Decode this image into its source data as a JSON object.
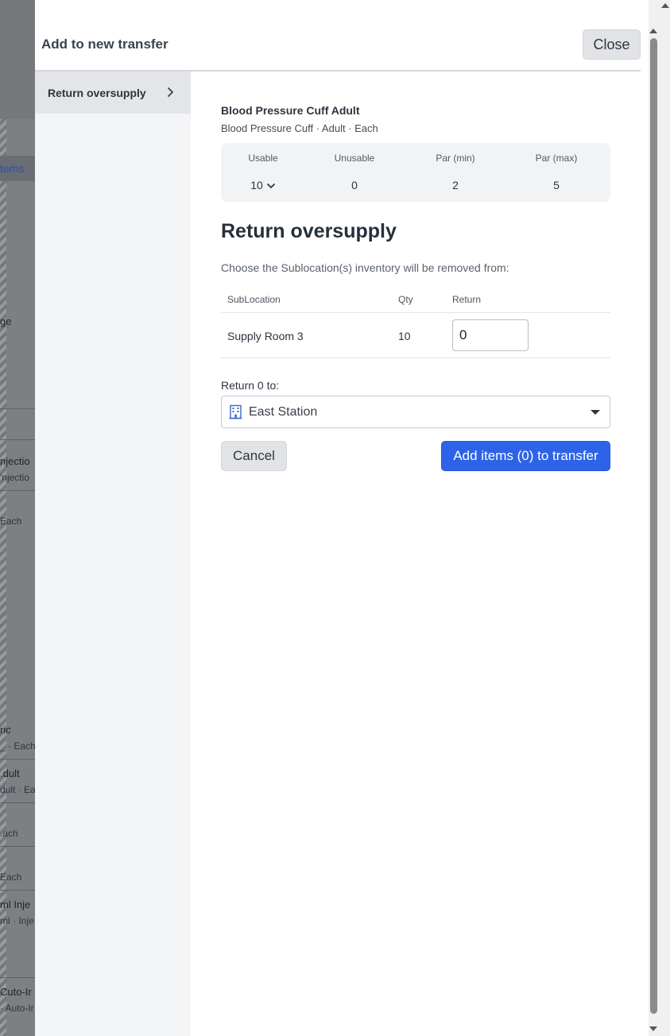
{
  "background_app": {
    "fragments": [
      {
        "text": "tems",
        "style": "link"
      },
      {
        "text": "ge",
        "style": "normal"
      },
      {
        "text": "njectio",
        "style": "normal"
      },
      {
        "text": "'njectio",
        "style": "small"
      },
      {
        "text": "Each",
        "style": "small"
      },
      {
        "text": "ric",
        "style": "normal"
      },
      {
        "text": "_ · Each",
        "style": "small"
      },
      {
        "text": ".dult",
        "style": "normal"
      },
      {
        "text": "dult · Ea",
        "style": "small"
      },
      {
        "text": ".ach",
        "style": "small"
      },
      {
        "text": "Each",
        "style": "small"
      },
      {
        "text": "ml Inje",
        "style": "normal"
      },
      {
        "text": "ml · Inje",
        "style": "small"
      },
      {
        "text": "Cuto-Ir",
        "style": "normal"
      },
      {
        "text": "· Auto-Ir",
        "style": "small"
      }
    ]
  },
  "modal": {
    "title": "Add to new transfer",
    "close_label": "Close"
  },
  "sidebar": {
    "items": [
      {
        "label": "Return oversupply",
        "icon": "chevron-right-icon"
      }
    ]
  },
  "item": {
    "name": "Blood Pressure Cuff Adult",
    "description": "Blood Pressure Cuff · Adult · Each"
  },
  "stats": {
    "usable_label": "Usable",
    "usable_value": "10",
    "unusable_label": "Unusable",
    "unusable_value": "0",
    "par_min_label": "Par (min)",
    "par_min_value": "2",
    "par_max_label": "Par (max)",
    "par_max_value": "5"
  },
  "section": {
    "title": "Return oversupply",
    "instruction": "Choose the Sublocation(s) inventory will be removed from:"
  },
  "table": {
    "headers": [
      "SubLocation",
      "Qty",
      "Return"
    ],
    "rows": [
      {
        "sublocation": "Supply Room 3",
        "qty": "10",
        "return_value": "0"
      }
    ]
  },
  "return_to": {
    "label": "Return 0 to:",
    "selected": "East Station",
    "icon": "building-icon"
  },
  "actions": {
    "cancel_label": "Cancel",
    "add_label": "Add items (0) to transfer"
  },
  "colors": {
    "primary": "#2d63e8",
    "secondary_button": "#e1e3e6",
    "sidebar_active": "#e3e5e8"
  }
}
